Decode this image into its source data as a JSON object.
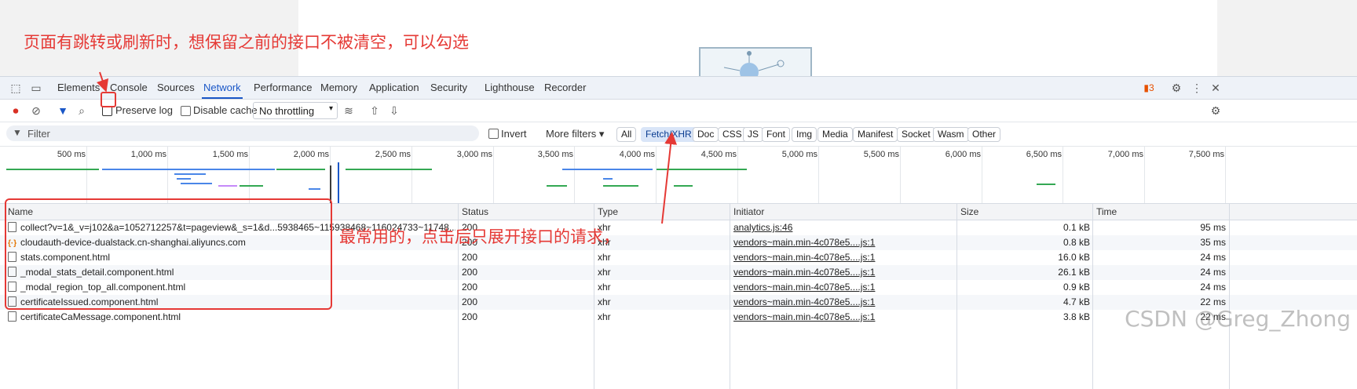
{
  "annotations": {
    "top_note": "页面有跳转或刷新时，想保留之前的接口不被清空，可以勾选",
    "middle_note": "最常用的，点击后只展开接口的请求，"
  },
  "tabs": [
    "Elements",
    "Console",
    "Sources",
    "Network",
    "Performance",
    "Memory",
    "Application",
    "Security",
    "Lighthouse",
    "Recorder"
  ],
  "active_tab": "Network",
  "issues_count": "3",
  "toolbar": {
    "preserve_log": "Preserve log",
    "disable_cache": "Disable cache",
    "throttling": "No throttling"
  },
  "filter": {
    "placeholder": "Filter",
    "invert": "Invert",
    "more_filters": "More filters",
    "types": [
      "All",
      "Fetch/XHR",
      "Doc",
      "CSS",
      "JS",
      "Font",
      "Img",
      "Media",
      "Manifest",
      "Socket",
      "Wasm",
      "Other"
    ],
    "active_type": "Fetch/XHR"
  },
  "timeline_ticks": [
    "500 ms",
    "1,000 ms",
    "1,500 ms",
    "2,000 ms",
    "2,500 ms",
    "3,000 ms",
    "3,500 ms",
    "4,000 ms",
    "4,500 ms",
    "5,000 ms",
    "5,500 ms",
    "6,000 ms",
    "6,500 ms",
    "7,000 ms",
    "7,500 ms"
  ],
  "columns": {
    "name": "Name",
    "status": "Status",
    "type": "Type",
    "initiator": "Initiator",
    "size": "Size",
    "time": "Time"
  },
  "requests": [
    {
      "name": "collect?v=1&_v=j102&a=1052712257&t=pageview&_s=1&d...5938465~115938468~116024733~11748...",
      "status": "200",
      "type": "xhr",
      "initiator": "analytics.js:46",
      "size": "0.1 kB",
      "time": "95 ms",
      "icon": "file-icon"
    },
    {
      "name": "cloudauth-device-dualstack.cn-shanghai.aliyuncs.com",
      "status": "200",
      "type": "xhr",
      "initiator": "vendors~main.min-4c078e5....js:1",
      "size": "0.8 kB",
      "time": "35 ms",
      "icon": "json-icon"
    },
    {
      "name": "stats.component.html",
      "status": "200",
      "type": "xhr",
      "initiator": "vendors~main.min-4c078e5....js:1",
      "size": "16.0 kB",
      "time": "24 ms",
      "icon": "file-icon"
    },
    {
      "name": "_modal_stats_detail.component.html",
      "status": "200",
      "type": "xhr",
      "initiator": "vendors~main.min-4c078e5....js:1",
      "size": "26.1 kB",
      "time": "24 ms",
      "icon": "file-icon"
    },
    {
      "name": "_modal_region_top_all.component.html",
      "status": "200",
      "type": "xhr",
      "initiator": "vendors~main.min-4c078e5....js:1",
      "size": "0.9 kB",
      "time": "24 ms",
      "icon": "file-icon"
    },
    {
      "name": "certificateIssued.component.html",
      "status": "200",
      "type": "xhr",
      "initiator": "vendors~main.min-4c078e5....js:1",
      "size": "4.7 kB",
      "time": "22 ms",
      "icon": "file-icon"
    },
    {
      "name": "certificateCaMessage.component.html",
      "status": "200",
      "type": "xhr",
      "initiator": "vendors~main.min-4c078e5....js:1",
      "size": "3.8 kB",
      "time": "22 ms",
      "icon": "file-icon"
    }
  ],
  "watermark": "CSDN @Greg_Zhong"
}
